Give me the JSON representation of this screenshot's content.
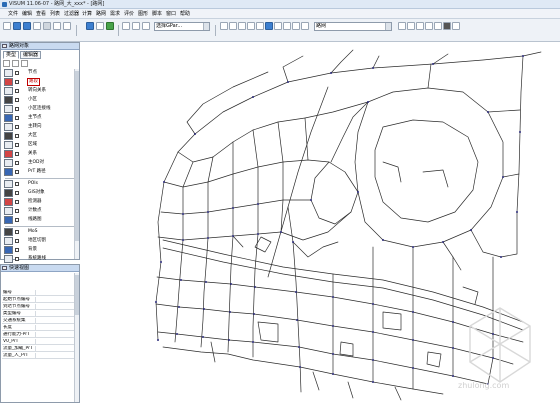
{
  "window": {
    "title": "VISUM 11.06-07 - 路网_大_xxx* - [路网]"
  },
  "menu": [
    "文件",
    "编辑",
    "查看",
    "列表",
    "过滤器",
    "计算",
    "路网",
    "需求",
    "评价",
    "图形",
    "脚本",
    "窗口",
    "帮助"
  ],
  "toolbar": {
    "graphics_combo": "选择GPar...",
    "mode_combo": "路网"
  },
  "network_panel": {
    "title": "路网对象",
    "tabs": [
      "类型",
      "编辑器"
    ],
    "layers": [
      {
        "label": "节点",
        "icon": "node-icon",
        "selected": false
      },
      {
        "label": "路段",
        "icon": "link-icon",
        "selected": true
      },
      {
        "label": "转向关系",
        "icon": "turn-icon",
        "selected": false
      },
      {
        "label": "小区",
        "icon": "zone-icon",
        "selected": false
      },
      {
        "label": "小区连接线",
        "icon": "connector-icon",
        "selected": false
      },
      {
        "label": "主节点",
        "icon": "main-node-icon",
        "selected": false
      },
      {
        "label": "主转向",
        "icon": "main-turn-icon",
        "selected": false
      },
      {
        "label": "大区",
        "icon": "main-zone-icon",
        "selected": false
      },
      {
        "label": "区域",
        "icon": "territory-icon",
        "selected": false
      },
      {
        "label": "关系",
        "icon": "relation-icon",
        "selected": false
      },
      {
        "label": "主OD对",
        "icon": "od-pair-icon",
        "selected": false
      },
      {
        "label": "PrT 路径",
        "icon": "path-icon",
        "selected": false
      },
      {
        "label": "POIs",
        "icon": "poi-icon",
        "selected": false
      },
      {
        "label": "GIS对象",
        "icon": "gis-icon",
        "selected": false
      },
      {
        "label": "检测器",
        "icon": "detector-icon",
        "selected": false
      },
      {
        "label": "计数点",
        "icon": "count-icon",
        "selected": false
      },
      {
        "label": "线路图",
        "icon": "line-icon",
        "selected": false
      },
      {
        "label": "MoS",
        "icon": "mos-icon",
        "selected": false
      },
      {
        "label": "地区切割",
        "icon": "cut-icon",
        "selected": false
      },
      {
        "label": "背景",
        "icon": "background-icon",
        "selected": false
      },
      {
        "label": "系统路线",
        "icon": "system-route-icon",
        "selected": false
      }
    ]
  },
  "quick_view": {
    "title": "快速视图",
    "rows": [
      "编号",
      "起始节点编号",
      "到达节点编号",
      "类型编号",
      "交通系统集",
      "长度",
      "通行能力-PrT",
      "V0_PrT",
      "流量_加载_PrT",
      "流量_人_PrT"
    ]
  },
  "watermark": {
    "text": "zhulong.com"
  }
}
